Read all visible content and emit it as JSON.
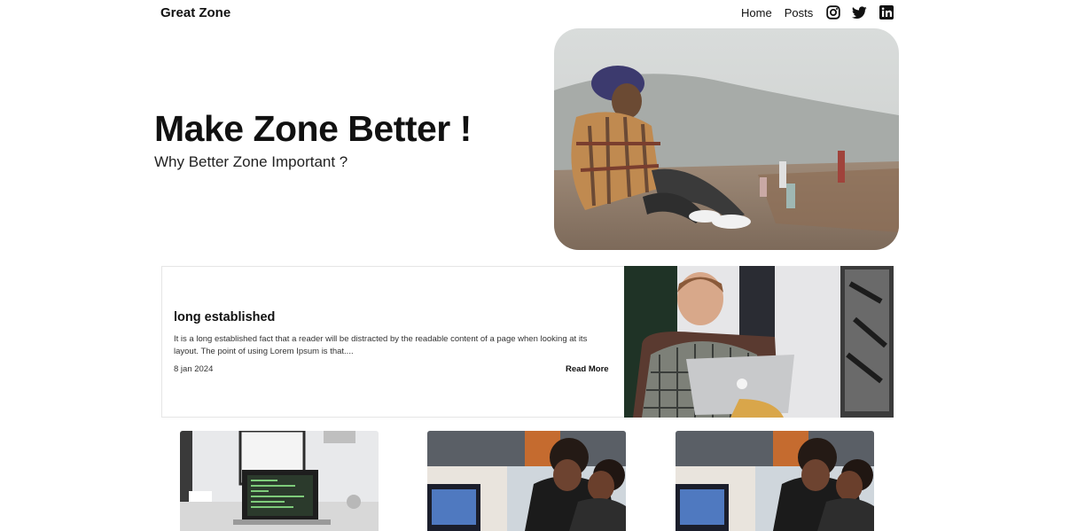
{
  "header": {
    "brand": "Great Zone",
    "nav": [
      {
        "label": "Home"
      },
      {
        "label": "Posts"
      }
    ],
    "social_icons": [
      "instagram-icon",
      "twitter-icon",
      "linkedin-icon"
    ]
  },
  "hero": {
    "title": "Make Zone Better !",
    "subtitle": "Why Better Zone Important ?"
  },
  "featured_post": {
    "title": "long established",
    "excerpt": "It is a long established fact that a reader will be distracted by the readable content of a page when looking at its layout. The point of using Lorem Ipsum is that....",
    "date": "8 jan 2024",
    "read_more": "Read More"
  },
  "colors": {
    "text": "#111111",
    "background": "#ffffff",
    "border": "#e6e6e6"
  }
}
